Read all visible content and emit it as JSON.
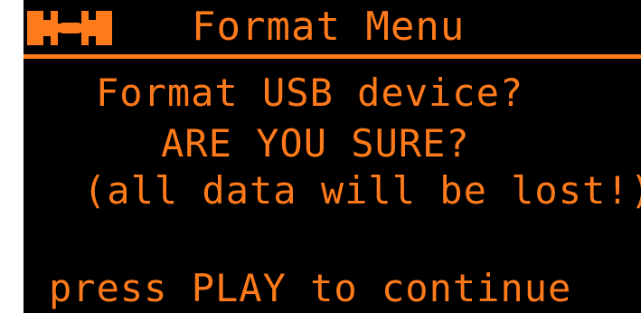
{
  "header": {
    "icon": "wrench-icon",
    "title": "Format Menu"
  },
  "dialog": {
    "question": "Format USB device?",
    "confirm": "ARE YOU SURE?",
    "warning": "(all data will be lost!)",
    "instruction": "press PLAY to continue"
  },
  "colors": {
    "text": "#ff7a1a",
    "background": "#000000"
  }
}
